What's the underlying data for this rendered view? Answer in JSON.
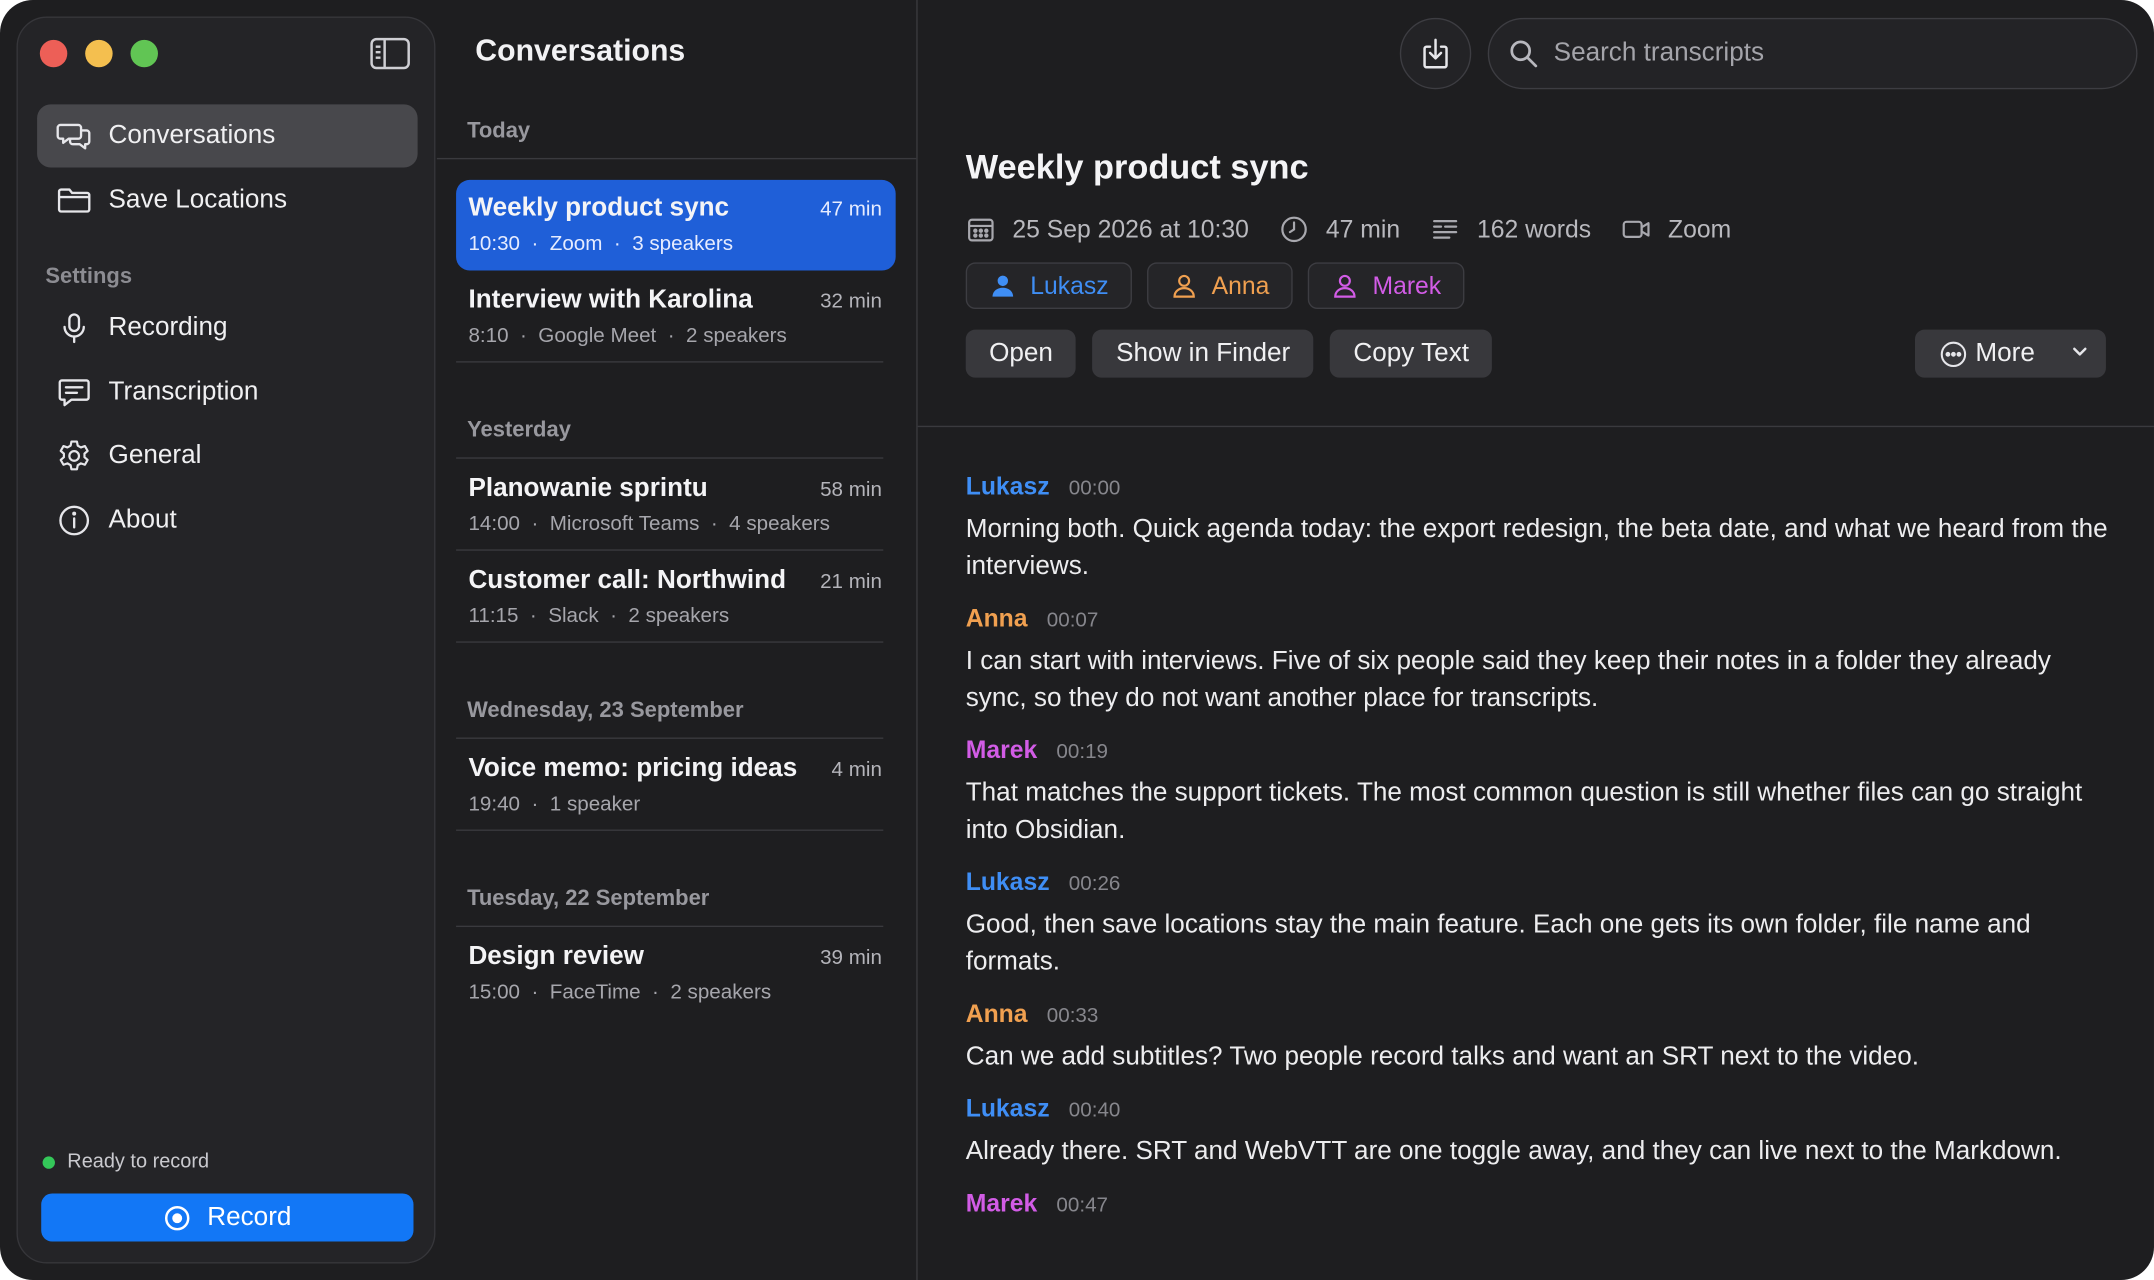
{
  "sidebar": {
    "nav": [
      {
        "label": "Conversations",
        "icon": "chat-bubbles-icon"
      },
      {
        "label": "Save Locations",
        "icon": "folder-icon"
      }
    ],
    "settings_label": "Settings",
    "settings": [
      {
        "label": "Recording",
        "icon": "microphone-icon"
      },
      {
        "label": "Transcription",
        "icon": "caption-icon"
      },
      {
        "label": "General",
        "icon": "gear-icon"
      },
      {
        "label": "About",
        "icon": "info-icon"
      }
    ],
    "status": "Ready to record",
    "record_label": "Record"
  },
  "list": {
    "title": "Conversations",
    "groups": [
      {
        "header": "Today",
        "items": [
          {
            "title": "Weekly product sync",
            "duration": "47 min",
            "meta": "10:30  ·  Zoom  ·  3 speakers",
            "selected": true
          },
          {
            "title": "Interview with Karolina",
            "duration": "32 min",
            "meta": "8:10  ·  Google Meet  ·  2 speakers"
          }
        ]
      },
      {
        "header": "Yesterday",
        "items": [
          {
            "title": "Planowanie sprintu",
            "duration": "58 min",
            "meta": "14:00  ·  Microsoft Teams  ·  4 speakers"
          },
          {
            "title": "Customer call: Northwind",
            "duration": "21 min",
            "meta": "11:15  ·  Slack  ·  2 speakers"
          }
        ]
      },
      {
        "header": "Wednesday, 23 September",
        "items": [
          {
            "title": "Voice memo: pricing ideas",
            "duration": "4 min",
            "meta": "19:40  ·  1 speaker"
          }
        ]
      },
      {
        "header": "Tuesday, 22 September",
        "items": [
          {
            "title": "Design review",
            "duration": "39 min",
            "meta": "15:00  ·  FaceTime  ·  2 speakers"
          }
        ]
      }
    ]
  },
  "detail": {
    "search_placeholder": "Search transcripts",
    "title": "Weekly product sync",
    "date": "25 Sep 2026 at 10:30",
    "duration": "47 min",
    "words": "162 words",
    "source": "Zoom",
    "speakers": [
      {
        "name": "Lukasz",
        "color": "#3f8ef5"
      },
      {
        "name": "Anna",
        "color": "#f0a050"
      },
      {
        "name": "Marek",
        "color": "#d25ce6"
      }
    ],
    "actions": {
      "open": "Open",
      "show_in_finder": "Show in Finder",
      "copy_text": "Copy Text",
      "more": "More"
    },
    "transcript": [
      {
        "speaker": "Lukasz",
        "time": "00:00",
        "text": "Morning both. Quick agenda today: the export redesign, the beta date, and what we heard from the interviews."
      },
      {
        "speaker": "Anna",
        "time": "00:07",
        "text": "I can start with interviews. Five of six people said they keep their notes in a folder they already sync, so they do not want another place for transcripts."
      },
      {
        "speaker": "Marek",
        "time": "00:19",
        "text": "That matches the support tickets. The most common question is still whether files can go straight into Obsidian."
      },
      {
        "speaker": "Lukasz",
        "time": "00:26",
        "text": "Good, then save locations stay the main feature. Each one gets its own folder, file name and formats."
      },
      {
        "speaker": "Anna",
        "time": "00:33",
        "text": "Can we add subtitles? Two people record talks and want an SRT next to the video."
      },
      {
        "speaker": "Lukasz",
        "time": "00:40",
        "text": "Already there. SRT and WebVTT are one toggle away, and they can live next to the Markdown."
      },
      {
        "speaker": "Marek",
        "time": "00:47",
        "text": ""
      }
    ]
  }
}
